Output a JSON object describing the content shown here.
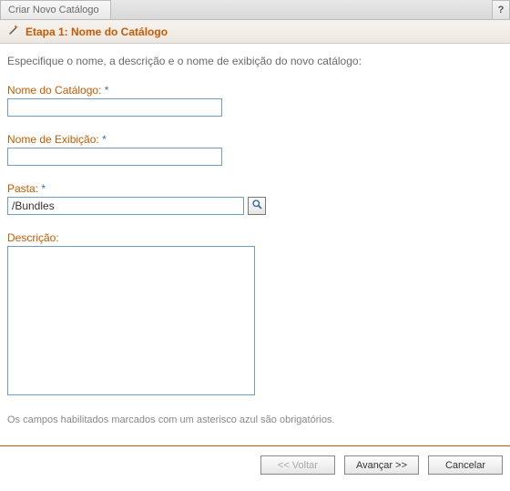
{
  "window": {
    "title": "Criar Novo Catálogo",
    "help_symbol": "?"
  },
  "step": {
    "label": "Etapa 1: Nome do Catálogo"
  },
  "instruction": "Especifique o nome, a descrição e o nome de exibição do novo catálogo:",
  "fields": {
    "name": {
      "label": "Nome do Catálogo:",
      "required_marker": "*",
      "value": ""
    },
    "display_name": {
      "label": "Nome de Exibição:",
      "required_marker": "*",
      "value": ""
    },
    "folder": {
      "label": "Pasta:",
      "required_marker": "*",
      "value": "/Bundles"
    },
    "description": {
      "label": "Descrição:",
      "value": ""
    }
  },
  "footnote": "Os campos habilitados marcados com um asterisco azul são obrigatórios.",
  "buttons": {
    "back": "<< Voltar",
    "next": "Avançar >>",
    "cancel": "Cancelar"
  }
}
